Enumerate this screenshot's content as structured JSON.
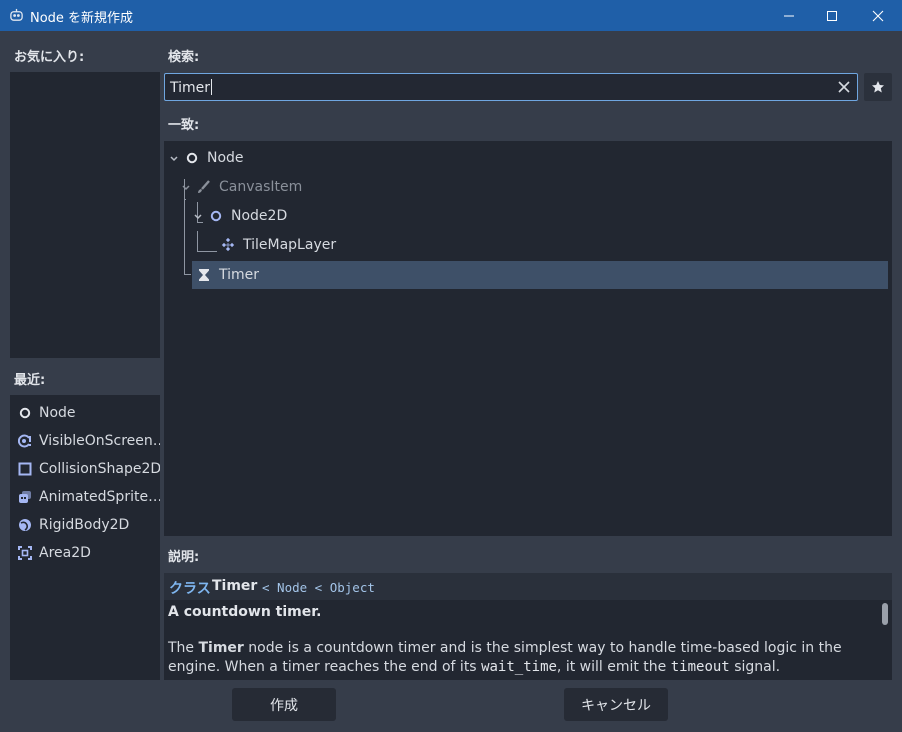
{
  "window": {
    "title": "Node を新規作成"
  },
  "labels": {
    "favorites": "お気に入り:",
    "recent": "最近:",
    "search": "検索:",
    "matches": "一致:",
    "description": "説明:"
  },
  "search": {
    "value": "Timer"
  },
  "recent": [
    {
      "label": "Node",
      "icon": "circle-outline-icon"
    },
    {
      "label": "VisibleOnScreen…",
      "icon": "visible-notifier-icon"
    },
    {
      "label": "CollisionShape2D",
      "icon": "square-outline-icon"
    },
    {
      "label": "AnimatedSprite…",
      "icon": "animated-sprite-icon"
    },
    {
      "label": "RigidBody2D",
      "icon": "rigid-body-icon"
    },
    {
      "label": "Area2D",
      "icon": "area-icon"
    }
  ],
  "tree": [
    {
      "label": "Node",
      "icon": "circle-outline-icon",
      "dimmed": false
    },
    {
      "label": "CanvasItem",
      "icon": "brush-icon",
      "dimmed": true
    },
    {
      "label": "Node2D",
      "icon": "circle-outline-icon",
      "dimmed": false
    },
    {
      "label": "TileMapLayer",
      "icon": "tilemap-icon",
      "dimmed": false
    },
    {
      "label": "Timer",
      "icon": "hourglass-icon",
      "dimmed": false,
      "selected": true
    }
  ],
  "description": {
    "class_keyword": "クラス",
    "class_name": "Timer",
    "inherits": "< Node < Object",
    "brief": "A countdown timer.",
    "body_1": "The ",
    "body_bold": "Timer",
    "body_2": " node is a countdown timer and is the simplest way to handle time-based logic in the engine. When a timer reaches the end of its ",
    "body_code_1": "wait_time",
    "body_3": ", it will emit the ",
    "body_code_2": "timeout",
    "body_4": " signal."
  },
  "buttons": {
    "create": "作成",
    "cancel": "キャンセル"
  },
  "colors": {
    "accent": "#6fa6e0",
    "titlebar": "#1f5fa8",
    "selection": "#3e5068",
    "node2d_icon": "#a5b7f3"
  }
}
